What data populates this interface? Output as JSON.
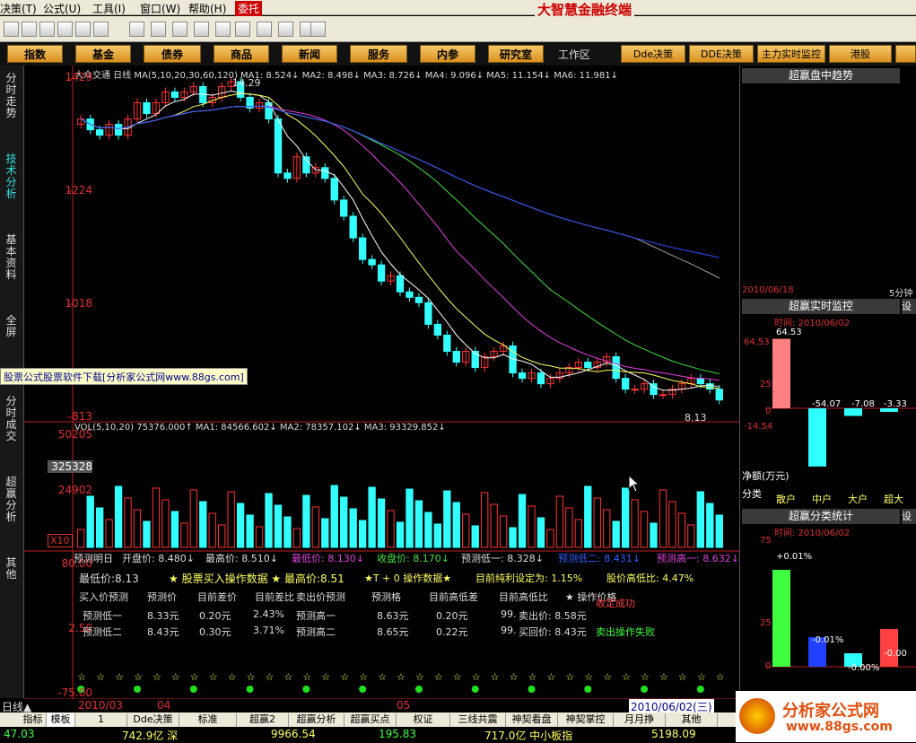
{
  "menu": {
    "items": [
      "决策(T)",
      "公式(U)",
      "工具(I)",
      "窗口(W)",
      "帮助(H)",
      "委托"
    ]
  },
  "window_title": "大智慧金融终端",
  "nav": {
    "buttons": [
      "指数",
      "基金",
      "债券",
      "商品",
      "新闻",
      "服务",
      "内参",
      "研究室",
      "工作区",
      "Dde决策",
      "DDE决策",
      "主力实时监控",
      "港股"
    ]
  },
  "left_tabs": [
    "分时走势",
    "技术分析",
    "基本资料",
    "全屏",
    "分时成交",
    "超赢分析",
    "其他"
  ],
  "chart": {
    "header": "大众交通 日线 MA(5,10,20,30,60,120) MA1: 8.524↓ MA2: 8.498↓ MA3: 8.726↓ MA4: 9.096↓ MA5: 11.154↓ MA6: 11.981↓",
    "y_ticks": [
      "1429",
      "1224",
      "1018",
      "813"
    ],
    "high_label": "14.29",
    "low_label": "8.13",
    "vol_header": "VOL(5,10,20) 75376.000↑ MA1: 84566.602↓ MA2: 78357.102↓ MA3: 93329.852↓",
    "vol_ticks": [
      "50205",
      "325328",
      "24902"
    ],
    "vol_unit": "X10",
    "osc_ticks": [
      "80.00",
      "2.50",
      "-75.00"
    ]
  },
  "chart_data": {
    "type": "candlestick",
    "title": "大众交通 日线",
    "ylim": [
      8.13,
      14.29
    ],
    "close": [
      13.6,
      13.4,
      13.3,
      13.5,
      13.3,
      13.6,
      13.9,
      13.7,
      13.9,
      14.1,
      14.0,
      14.1,
      14.2,
      13.9,
      14.0,
      14.2,
      14.29,
      14.0,
      13.8,
      13.9,
      13.6,
      12.6,
      12.5,
      12.9,
      12.6,
      12.7,
      12.5,
      12.1,
      11.8,
      11.4,
      11.0,
      10.9,
      10.6,
      10.7,
      10.4,
      10.3,
      10.2,
      9.8,
      9.6,
      9.3,
      9.1,
      9.3,
      9.0,
      9.2,
      9.3,
      9.4,
      8.9,
      8.8,
      8.9,
      8.7,
      8.8,
      8.9,
      9.0,
      9.1,
      9.0,
      9.1,
      9.2,
      8.8,
      8.6,
      8.6,
      8.7,
      8.5,
      8.5,
      8.6,
      8.7,
      8.8,
      8.7,
      8.6,
      8.4
    ],
    "series": [
      {
        "name": "MA1",
        "last": 8.524
      },
      {
        "name": "MA2",
        "last": 8.498
      },
      {
        "name": "MA3",
        "last": 8.726
      },
      {
        "name": "MA4",
        "last": 9.096
      },
      {
        "name": "MA5",
        "last": 11.154
      },
      {
        "name": "MA6",
        "last": 11.981
      }
    ]
  },
  "info": {
    "row1": [
      "预测明日",
      "开盘价: 8.480↓",
      "最高价: 8.510↓",
      "最低价: 8.130↓",
      "收盘价: 8.170↓",
      "预测低一: 8.328↓",
      "预测低二: 8.431↓",
      "预测高一: 8.632↓"
    ],
    "row2": [
      "最低价:8.13",
      "★ 股票买入操作数据 ★ 最高价:8.51",
      "★T + 0 操作数据★",
      "目前纯利设定为: 1.15%",
      "股价高低比: 4.47%"
    ],
    "hdr": [
      "买入价预测",
      "预测价",
      "目前差价",
      "目前差比",
      "卖出价预测",
      "预测格",
      "目前高低差",
      "目前高低比",
      "★ 操作价格"
    ],
    "r1": [
      "预测低一",
      "8.33元",
      "0.20元",
      "2.43%",
      "预测高一",
      "8.63元",
      "0.20元",
      "99.",
      "卖出价: 8.58元",
      "收定成功"
    ],
    "r2": [
      "预测低二",
      "8.43元",
      "0.30元",
      "3.71%",
      "预测高二",
      "8.65元",
      "0.22元",
      "99.",
      "买回价: 8.43元",
      "卖出操作失败"
    ]
  },
  "time_axis": {
    "labels": [
      "日线▲",
      "2010/03",
      "04",
      "05",
      "2010/06/02(三)"
    ]
  },
  "bottom_tabs": [
    "指标",
    "模板",
    "1",
    "Dde决策",
    "标准",
    "超赢2",
    "超赢分析",
    "超赢买点",
    "权证",
    "三线共震",
    "神契看盘",
    "神契掌控",
    "月月挣",
    "其他"
  ],
  "status": {
    "items": [
      "47.03",
      "742.9亿 深",
      "9966.54",
      "195.83",
      "717.0亿 中小板指",
      "5198.09"
    ]
  },
  "right_panel": {
    "trend_title": "超赢盘中趋势",
    "trend_date": "2010/06/18",
    "trend_unit": "5分钟",
    "monitor_title": "超赢实时监控",
    "monitor_time": "时间: 2010/06/02",
    "monitor_axis": [
      "64.53",
      "25",
      "0",
      "-14.54"
    ],
    "monitor_values": [
      "64.53",
      "-54.07",
      "-7.08",
      "-3.33"
    ],
    "monitor_values_num": [
      64.53,
      -54.07,
      -7.08,
      -3.33
    ],
    "monitor_caption": "净额(万元)",
    "monitor_categories": [
      "散户",
      "中户",
      "大户",
      "超大"
    ],
    "class_label": "分类",
    "class_title": "超赢分类统计",
    "class_time": "时间: 2010/06/02",
    "class_axis": [
      "75",
      "25",
      "0"
    ],
    "class_values": [
      "+0.01%",
      "-0.01%",
      "-0.00%",
      "-0.00"
    ],
    "class_values_num": [
      72,
      22,
      10,
      28
    ],
    "stub1": "设",
    "stub2": "设"
  },
  "logo_text": "分析家公式网",
  "logo_url": "www.88gs.com",
  "promo": "股票公式股票软件下载[分析家公式网www.88gs.com]",
  "colors": {
    "up": "#ff3333",
    "down": "#33ffff",
    "bg": "#000000",
    "nav": "#e9a63a"
  }
}
